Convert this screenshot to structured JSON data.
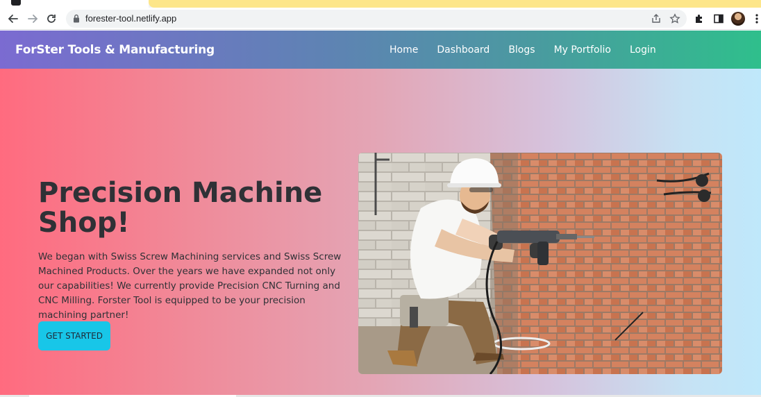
{
  "browser": {
    "url": "forester-tool.netlify.app",
    "icons": [
      "back-arrow",
      "forward-arrow",
      "reload",
      "lock",
      "share",
      "star",
      "extensions-puzzle",
      "side-panel",
      "profile-avatar",
      "menu-kebab"
    ]
  },
  "site": {
    "brand": "ForSter Tools & Manufacturing",
    "nav": [
      "Home",
      "Dashboard",
      "Blogs",
      "My Portfolio",
      "Login"
    ]
  },
  "hero": {
    "title": "Precision Machine Shop!",
    "text": "We began with Swiss Screw Machining services and Swiss Screw Machined Products. Over the years we have expanded not only our capabilities! We currently provide Precision CNC Turning and CNC Milling. Forster Tool is equipped to be your precision machining partner!",
    "cta_label": "GET STARTED",
    "image": "worker-drilling-brick-wall"
  },
  "colors": {
    "nav_gradient_start": "#7b6bd1",
    "nav_gradient_end": "#2fbf8c",
    "hero_gradient_start": "#ff6b7f",
    "hero_gradient_end": "#bfe8fb",
    "cta": "#18c6e8",
    "text_dark": "#2f3136"
  }
}
